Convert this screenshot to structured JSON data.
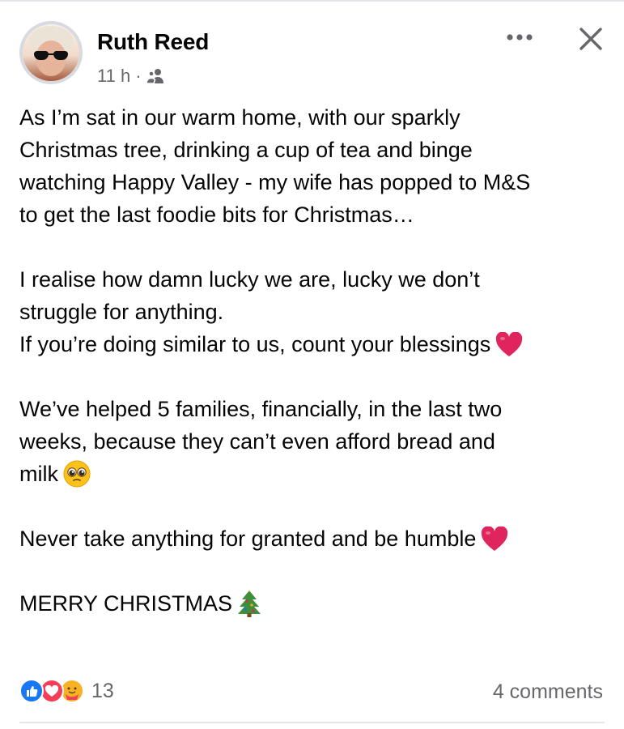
{
  "post": {
    "author": "Ruth Reed",
    "time": "11 h",
    "separator": "·",
    "audience_icon": "friends-icon",
    "paragraphs": [
      {
        "lines": [
          "As I’m sat in our warm home, with our sparkly",
          "Christmas tree, drinking a cup of tea and binge",
          "watching Happy Valley - my wife has popped to M&S",
          "to get the last foodie bits for Christmas…"
        ]
      },
      {
        "lines": [
          "I realise how damn lucky we are, lucky we don’t",
          "struggle for anything.",
          "If you’re doing similar to us, count your blessings"
        ]
      },
      {
        "lines": [
          "We’ve helped 5 families, financially, in the last two",
          "weeks, because they can’t even afford bread and",
          "milk"
        ]
      },
      {
        "lines": [
          "Never take anything for granted and be humble"
        ]
      },
      {
        "lines": [
          "MERRY CHRISTMAS"
        ]
      }
    ],
    "emojis": [
      "red-heart-emoji",
      "pleading-face-emoji",
      "red-heart-emoji",
      "christmas-tree-emoji"
    ]
  },
  "footer": {
    "reaction_count": "13",
    "comments": "4 comments",
    "reaction_icons": [
      "like-icon",
      "love-icon",
      "care-icon"
    ]
  },
  "colors": {
    "text": "#050505",
    "secondary": "#65676b",
    "like": "#1877f2",
    "love": "#f33e58",
    "care": "#f7b125",
    "divider": "#e4e6eb"
  }
}
